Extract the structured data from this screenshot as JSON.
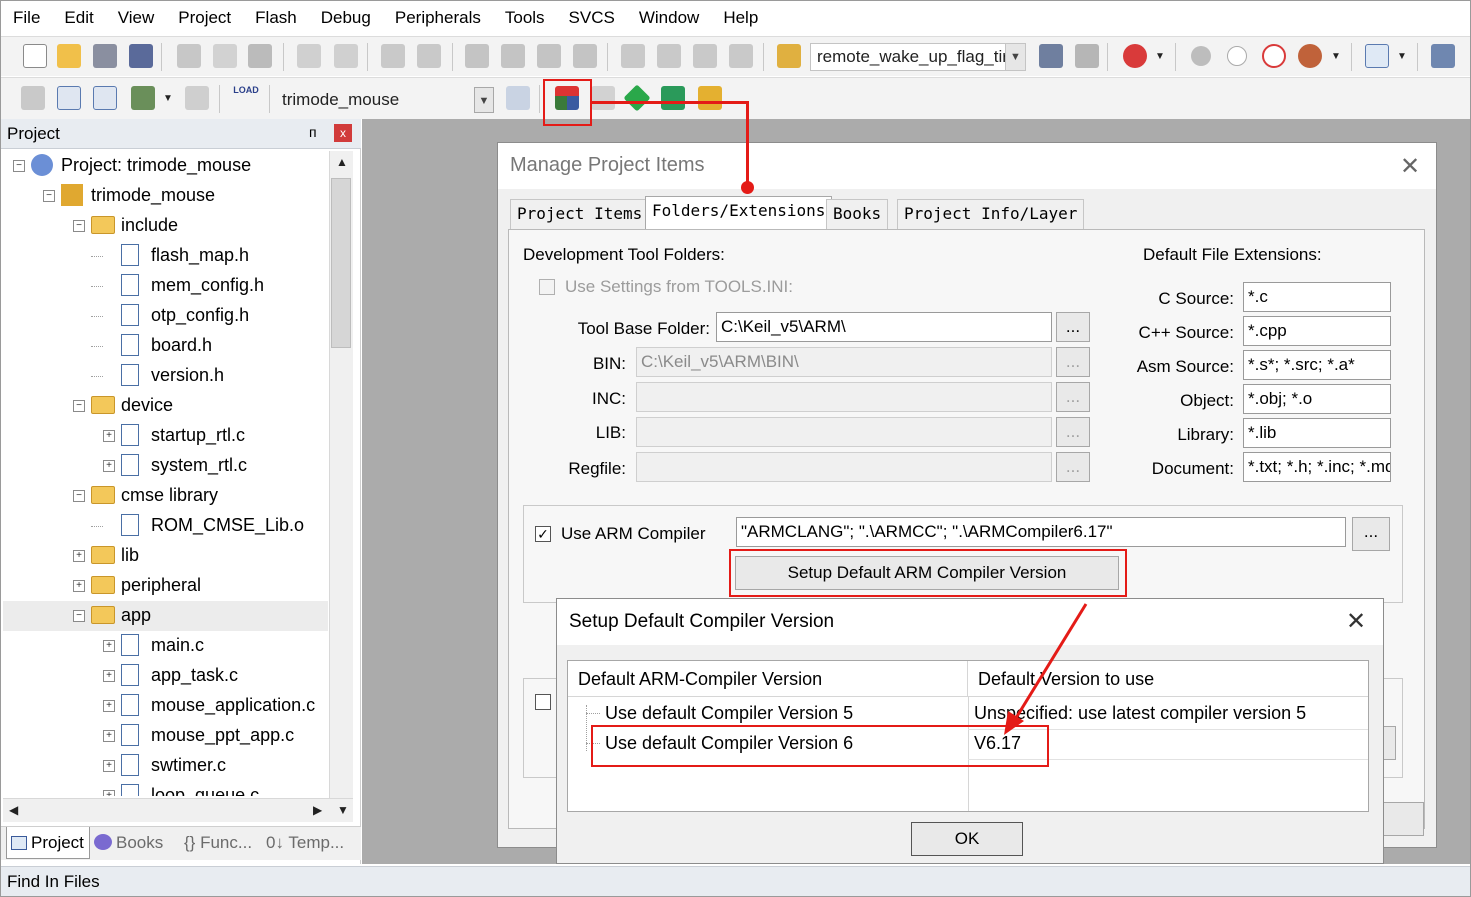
{
  "menu": [
    "File",
    "Edit",
    "View",
    "Project",
    "Flash",
    "Debug",
    "Peripherals",
    "Tools",
    "SVCS",
    "Window",
    "Help"
  ],
  "toolbar": {
    "find_combo_value": "remote_wake_up_flag_tir",
    "target_combo_value": "trimode_mouse",
    "load_icon_text": "LOAD"
  },
  "project_panel": {
    "title": "Project",
    "pin_glyph": "ᴨ",
    "close_glyph": "x",
    "tree": [
      {
        "label": "Project: trimode_mouse",
        "level": 0,
        "kind": "project",
        "expander": "−"
      },
      {
        "label": "trimode_mouse",
        "level": 1,
        "kind": "target",
        "expander": "−"
      },
      {
        "label": "include",
        "level": 2,
        "kind": "folder",
        "expander": "−"
      },
      {
        "label": "flash_map.h",
        "level": 3,
        "kind": "file",
        "expander": ""
      },
      {
        "label": "mem_config.h",
        "level": 3,
        "kind": "file",
        "expander": ""
      },
      {
        "label": "otp_config.h",
        "level": 3,
        "kind": "file",
        "expander": ""
      },
      {
        "label": "board.h",
        "level": 3,
        "kind": "file",
        "expander": ""
      },
      {
        "label": "version.h",
        "level": 3,
        "kind": "file",
        "expander": ""
      },
      {
        "label": "device",
        "level": 2,
        "kind": "folder",
        "expander": "−"
      },
      {
        "label": "startup_rtl.c",
        "level": 3,
        "kind": "file",
        "expander": "+"
      },
      {
        "label": "system_rtl.c",
        "level": 3,
        "kind": "file",
        "expander": "+"
      },
      {
        "label": "cmse library",
        "level": 2,
        "kind": "folder",
        "expander": "−"
      },
      {
        "label": "ROM_CMSE_Lib.o",
        "level": 3,
        "kind": "file",
        "expander": ""
      },
      {
        "label": "lib",
        "level": 2,
        "kind": "folder",
        "expander": "+"
      },
      {
        "label": "peripheral",
        "level": 2,
        "kind": "folder",
        "expander": "+"
      },
      {
        "label": "app",
        "level": 2,
        "kind": "folder",
        "expander": "−",
        "selected": true
      },
      {
        "label": "main.c",
        "level": 3,
        "kind": "file",
        "expander": "+"
      },
      {
        "label": "app_task.c",
        "level": 3,
        "kind": "file",
        "expander": "+"
      },
      {
        "label": "mouse_application.c",
        "level": 3,
        "kind": "file",
        "expander": "+"
      },
      {
        "label": "mouse_ppt_app.c",
        "level": 3,
        "kind": "file",
        "expander": "+"
      },
      {
        "label": "swtimer.c",
        "level": 3,
        "kind": "file",
        "expander": "+"
      },
      {
        "label": "loop_queue.c",
        "level": 3,
        "kind": "file",
        "expander": "+"
      }
    ],
    "tabs": [
      "Project",
      "Books",
      "{} Func...",
      "0↓ Temp..."
    ]
  },
  "status_bar": "Find In Files",
  "manage_dialog": {
    "title": "Manage Project Items",
    "close_glyph": "✕",
    "tabs": [
      "Project Items",
      "Folders/Extensions",
      "Books",
      "Project Info/Layer"
    ],
    "active_tab": "Folders/Extensions",
    "dev_tool_folders_label": "Development Tool Folders:",
    "use_settings_label": "Use Settings from TOOLS.INI:",
    "fields": [
      {
        "label": "Tool Base Folder:",
        "value": "C:\\Keil_v5\\ARM\\",
        "enabled": true
      },
      {
        "label": "BIN:",
        "value": "C:\\Keil_v5\\ARM\\BIN\\",
        "enabled": false
      },
      {
        "label": "INC:",
        "value": "",
        "enabled": false
      },
      {
        "label": "LIB:",
        "value": "",
        "enabled": false
      },
      {
        "label": "Regfile:",
        "value": "",
        "enabled": false
      }
    ],
    "browse_label": "...",
    "default_ext_label": "Default File Extensions:",
    "extensions": [
      {
        "label": "C Source:",
        "value": "*.c"
      },
      {
        "label": "C++ Source:",
        "value": "*.cpp"
      },
      {
        "label": "Asm Source:",
        "value": "*.s*; *.src; *.a*"
      },
      {
        "label": "Object:",
        "value": "*.obj; *.o"
      },
      {
        "label": "Library:",
        "value": "*.lib"
      },
      {
        "label": "Document:",
        "value": "*.txt; *.h; *.inc; *.md"
      }
    ],
    "use_arm_compiler_label": "Use ARM Compiler",
    "use_arm_compiler_checked": "✓",
    "arm_compiler_value": "\"ARMCLANG\"; \".\\ARMCC\"; \".\\ARMCompiler6.17\"",
    "setup_button_label": "Setup Default ARM Compiler Version"
  },
  "setup_dialog": {
    "title": "Setup Default Compiler Version",
    "close_glyph": "✕",
    "col1_header": "Default ARM-Compiler Version",
    "col2_header": "Default Version to use",
    "rows": [
      {
        "name": "Use default Compiler Version 5",
        "value": "Unspecified: use latest compiler version 5"
      },
      {
        "name": "Use default Compiler Version 6",
        "value": "V6.17"
      }
    ],
    "ok_label": "OK"
  },
  "colors": {
    "annotation_red": "#e41b17",
    "panel_header": "#e8ecf1",
    "editor_background": "#ababab"
  }
}
